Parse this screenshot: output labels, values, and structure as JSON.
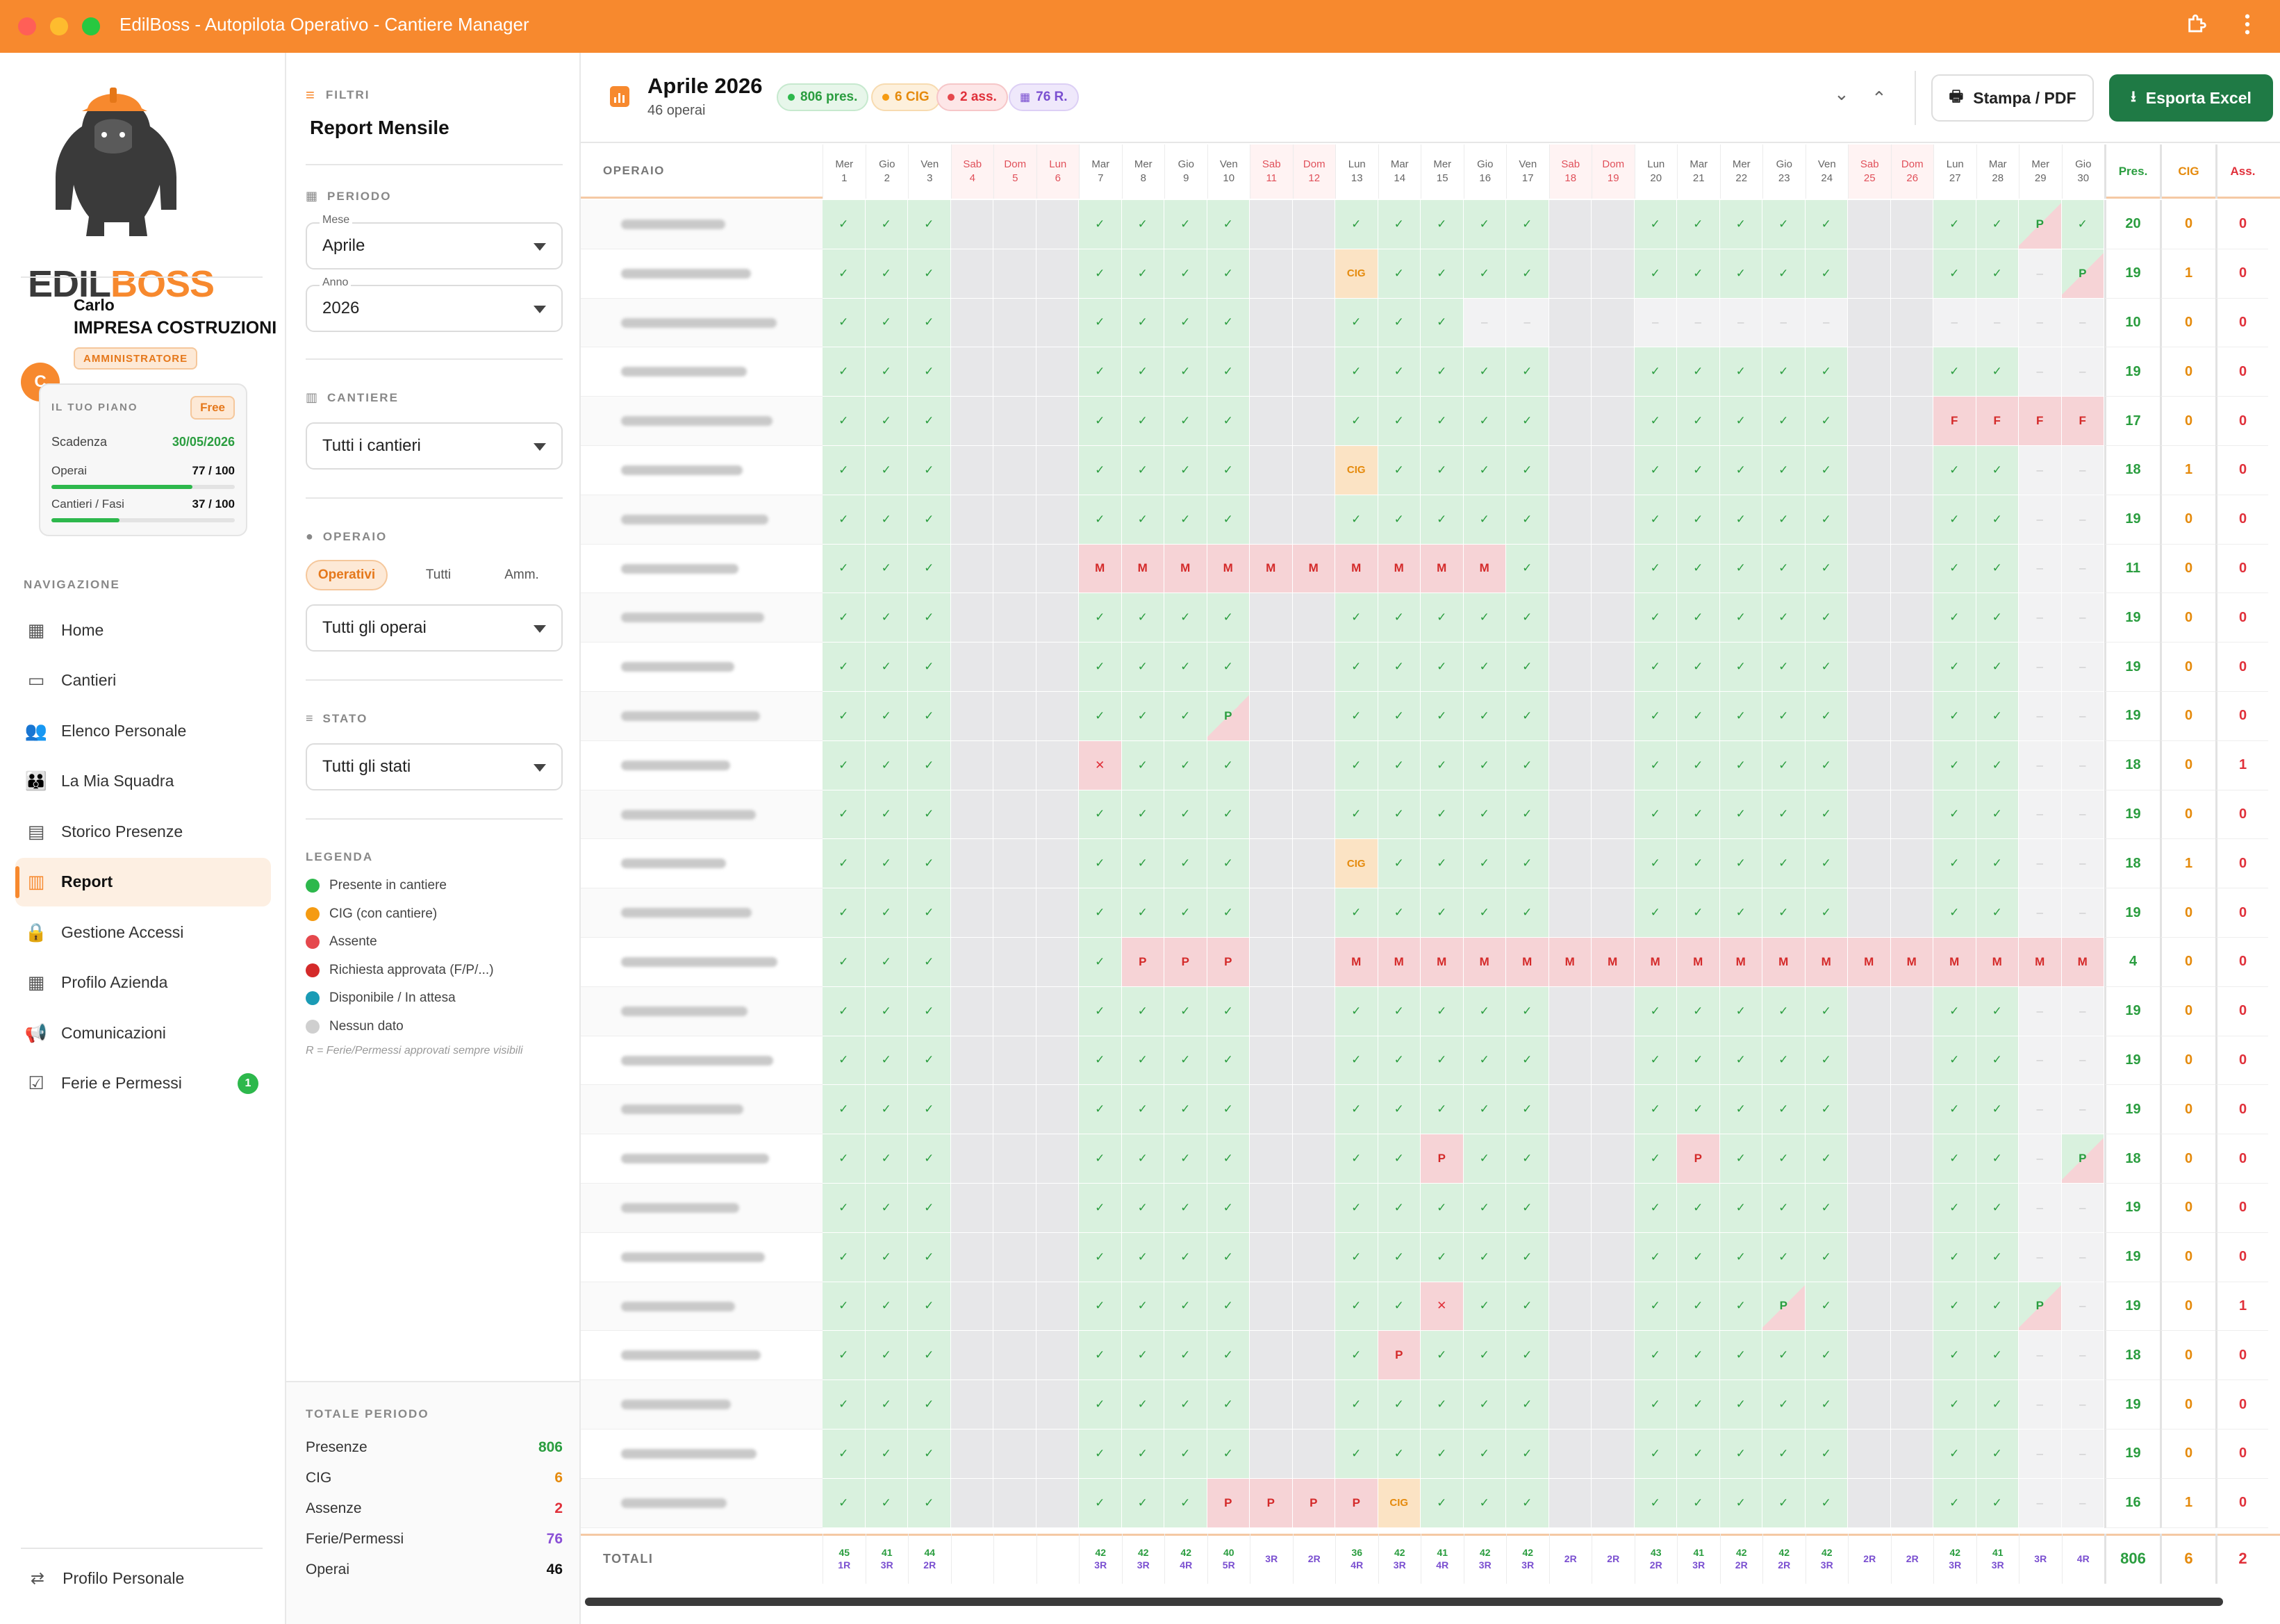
{
  "window": {
    "title": "EdilBoss - Autopilota Operativo - Cantiere Manager"
  },
  "brand": {
    "logo_text_1": "EDIL",
    "logo_text_2": "BOSS",
    "accent": "#f7892e"
  },
  "user": {
    "avatar_letter": "C",
    "first_name": "Carlo",
    "company": "IMPRESA COSTRUZIONI",
    "role": "AMMINISTRATORE"
  },
  "plan": {
    "title": "IL TUO PIANO",
    "tier": "Free",
    "expiry_label": "Scadenza",
    "expiry_value": "30/05/2026",
    "workers_label": "Operai",
    "workers_value": "77 / 100",
    "workers_fraction": 0.77,
    "sites_label": "Cantieri / Fasi",
    "sites_value": "37 / 100",
    "sites_fraction": 0.37
  },
  "nav": {
    "section": "NAVIGAZIONE",
    "items": [
      {
        "label": "Home",
        "icon": "dashboard-icon"
      },
      {
        "label": "Cantieri",
        "icon": "building-icon"
      },
      {
        "label": "Elenco Personale",
        "icon": "people-icon"
      },
      {
        "label": "La Mia Squadra",
        "icon": "team-icon"
      },
      {
        "label": "Storico Presenze",
        "icon": "calendar-icon"
      },
      {
        "label": "Report",
        "icon": "report-icon",
        "active": true
      },
      {
        "label": "Gestione Accessi",
        "icon": "lock-icon"
      },
      {
        "label": "Profilo Azienda",
        "icon": "company-icon"
      },
      {
        "label": "Comunicazioni",
        "icon": "megaphone-icon"
      },
      {
        "label": "Ferie e Permessi",
        "icon": "calendar-check-icon",
        "badge": "1"
      }
    ],
    "profile": "Profilo Personale"
  },
  "filters": {
    "header": "FILTRI",
    "title": "Report Mensile",
    "period_label": "PERIODO",
    "month_label": "Mese",
    "month_value": "Aprile",
    "year_label": "Anno",
    "year_value": "2026",
    "site_label": "CANTIERE",
    "site_value": "Tutti i cantieri",
    "worker_label": "OPERAIO",
    "worker_tabs": [
      "Operativi",
      "Tutti",
      "Amm."
    ],
    "worker_value": "Tutti gli operai",
    "status_label": "STATO",
    "status_value": "Tutti gli stati",
    "legend_label": "LEGENDA",
    "legend": [
      {
        "label": "Presente in cantiere",
        "color": "#2db84c"
      },
      {
        "label": "CIG (con cantiere)",
        "color": "#f59b12"
      },
      {
        "label": "Assente",
        "color": "#e5484d"
      },
      {
        "label": "Richiesta approvata (F/P/...)",
        "color": "#d42a2a"
      },
      {
        "label": "Disponibile / In attesa",
        "color": "#1a9bb5"
      },
      {
        "label": "Nessun dato",
        "color": "#cfcfcf"
      }
    ],
    "legend_note": "R = Ferie/Permessi approvati sempre visibili"
  },
  "period_totals": {
    "title": "TOTALE PERIODO",
    "rows": [
      {
        "label": "Presenze",
        "value": "806",
        "color": "#2a9d3f"
      },
      {
        "label": "CIG",
        "value": "6",
        "color": "#e58a0c"
      },
      {
        "label": "Assenze",
        "value": "2",
        "color": "#e0303a"
      },
      {
        "label": "Ferie/Permessi",
        "value": "76",
        "color": "#8a4fd6"
      },
      {
        "label": "Operai",
        "value": "46",
        "color": "#111"
      }
    ]
  },
  "report": {
    "title": "Aprile 2026",
    "subtitle": "46 operai",
    "pills": [
      {
        "text": "806 pres.",
        "color": "#2a9d3f",
        "bg": "#e7f6ea"
      },
      {
        "text": "6 CIG",
        "color": "#e58a0c",
        "bg": "#fdf0dc"
      },
      {
        "text": "2 ass.",
        "color": "#e0303a",
        "bg": "#fde6e7"
      },
      {
        "text": "76 R.",
        "color": "#7a4fd0",
        "bg": "#efe8fb"
      }
    ],
    "print_button": "Stampa / PDF",
    "export_button": "Esporta Excel",
    "col_operaio": "OPERAIO",
    "col_pres": "Pres.",
    "col_cig": "CIG",
    "col_ass": "Ass.",
    "totals_label": "TOTALI",
    "days": [
      {
        "wd": "Mer",
        "d": "1"
      },
      {
        "wd": "Gio",
        "d": "2"
      },
      {
        "wd": "Ven",
        "d": "3"
      },
      {
        "wd": "Sab",
        "d": "4",
        "we": true
      },
      {
        "wd": "Dom",
        "d": "5",
        "we": true
      },
      {
        "wd": "Lun",
        "d": "6",
        "we": true
      },
      {
        "wd": "Mar",
        "d": "7"
      },
      {
        "wd": "Mer",
        "d": "8"
      },
      {
        "wd": "Gio",
        "d": "9"
      },
      {
        "wd": "Ven",
        "d": "10"
      },
      {
        "wd": "Sab",
        "d": "11",
        "we": true
      },
      {
        "wd": "Dom",
        "d": "12",
        "we": true
      },
      {
        "wd": "Lun",
        "d": "13"
      },
      {
        "wd": "Mar",
        "d": "14"
      },
      {
        "wd": "Mer",
        "d": "15"
      },
      {
        "wd": "Gio",
        "d": "16"
      },
      {
        "wd": "Ven",
        "d": "17"
      },
      {
        "wd": "Sab",
        "d": "18",
        "we": true
      },
      {
        "wd": "Dom",
        "d": "19",
        "we": true
      },
      {
        "wd": "Lun",
        "d": "20"
      },
      {
        "wd": "Mar",
        "d": "21"
      },
      {
        "wd": "Mer",
        "d": "22"
      },
      {
        "wd": "Gio",
        "d": "23"
      },
      {
        "wd": "Ven",
        "d": "24"
      },
      {
        "wd": "Sab",
        "d": "25",
        "we": true
      },
      {
        "wd": "Dom",
        "d": "26",
        "we": true
      },
      {
        "wd": "Lun",
        "d": "27"
      },
      {
        "wd": "Mar",
        "d": "28"
      },
      {
        "wd": "Mer",
        "d": "29"
      },
      {
        "wd": "Gio",
        "d": "30"
      }
    ],
    "rows": [
      {
        "pres": "20",
        "cig": "0",
        "ass": "0",
        "ex": {
          "29": "P/"
        }
      },
      {
        "pres": "19",
        "cig": "1",
        "ass": "0",
        "ex": {
          "13": "C",
          "29": "-",
          "30": "P/"
        }
      },
      {
        "pres": "10",
        "cig": "0",
        "ass": "0",
        "ex": {
          "16": "-",
          "17": "-",
          "20": "-",
          "21": "-",
          "22": "-",
          "23": "-",
          "24": "-",
          "27": "-",
          "28": "-",
          "29": "-",
          "30": "-"
        }
      },
      {
        "pres": "19",
        "cig": "0",
        "ass": "0",
        "ex": {
          "29": "-",
          "30": "-"
        }
      },
      {
        "pres": "17",
        "cig": "0",
        "ass": "0",
        "ex": {
          "27": "F",
          "28": "F",
          "29": "F",
          "30": "F"
        }
      },
      {
        "pres": "18",
        "cig": "1",
        "ass": "0",
        "ex": {
          "13": "C",
          "29": "-",
          "30": "-"
        }
      },
      {
        "pres": "19",
        "cig": "0",
        "ass": "0",
        "ex": {
          "29": "-",
          "30": "-"
        }
      },
      {
        "pres": "11",
        "cig": "0",
        "ass": "0",
        "ex": {
          "7": "M",
          "8": "M",
          "9": "M",
          "10": "M",
          "11": "M",
          "12": "M",
          "13": "M",
          "14": "M",
          "15": "M",
          "16": "M",
          "29": "-",
          "30": "-"
        }
      },
      {
        "pres": "19",
        "cig": "0",
        "ass": "0",
        "ex": {
          "29": "-",
          "30": "-"
        }
      },
      {
        "pres": "19",
        "cig": "0",
        "ass": "0",
        "ex": {
          "29": "-",
          "30": "-"
        }
      },
      {
        "pres": "19",
        "cig": "0",
        "ass": "0",
        "ex": {
          "10": "P/",
          "29": "-",
          "30": "-"
        }
      },
      {
        "pres": "18",
        "cig": "0",
        "ass": "1",
        "ex": {
          "7": "X",
          "29": "-",
          "30": "-"
        }
      },
      {
        "pres": "19",
        "cig": "0",
        "ass": "0",
        "ex": {
          "29": "-",
          "30": "-"
        }
      },
      {
        "pres": "18",
        "cig": "1",
        "ass": "0",
        "ex": {
          "13": "C",
          "29": "-",
          "30": "-"
        }
      },
      {
        "pres": "19",
        "cig": "0",
        "ass": "0",
        "ex": {
          "29": "-",
          "30": "-"
        }
      },
      {
        "pres": "4",
        "cig": "0",
        "ass": "0",
        "ex": {
          "8": "P",
          "9": "P",
          "10": "P",
          "13": "M",
          "14": "M",
          "15": "M",
          "16": "M",
          "17": "M",
          "18": "M",
          "19": "M",
          "20": "M",
          "21": "M",
          "22": "M",
          "23": "M",
          "24": "M",
          "25": "M",
          "26": "M",
          "27": "M",
          "28": "M",
          "29": "M",
          "30": "M"
        }
      },
      {
        "pres": "19",
        "cig": "0",
        "ass": "0",
        "ex": {
          "29": "-",
          "30": "-"
        }
      },
      {
        "pres": "19",
        "cig": "0",
        "ass": "0",
        "ex": {
          "29": "-",
          "30": "-"
        }
      },
      {
        "pres": "19",
        "cig": "0",
        "ass": "0",
        "ex": {
          "29": "-",
          "30": "-"
        }
      },
      {
        "pres": "18",
        "cig": "0",
        "ass": "0",
        "ex": {
          "15": "P",
          "21": "P",
          "29": "-",
          "30": "P/"
        }
      },
      {
        "pres": "19",
        "cig": "0",
        "ass": "0",
        "ex": {
          "29": "-",
          "30": "-"
        }
      },
      {
        "pres": "19",
        "cig": "0",
        "ass": "0",
        "ex": {
          "29": "-",
          "30": "-"
        }
      },
      {
        "pres": "19",
        "cig": "0",
        "ass": "1",
        "ex": {
          "15": "X",
          "23": "P/",
          "29": "P/",
          "30": "-"
        }
      },
      {
        "pres": "18",
        "cig": "0",
        "ass": "0",
        "ex": {
          "14": "P",
          "29": "-",
          "30": "-"
        }
      },
      {
        "pres": "19",
        "cig": "0",
        "ass": "0",
        "ex": {
          "29": "-",
          "30": "-"
        }
      },
      {
        "pres": "19",
        "cig": "0",
        "ass": "0",
        "ex": {
          "29": "-",
          "30": "-"
        }
      },
      {
        "pres": "16",
        "cig": "1",
        "ass": "0",
        "ex": {
          "10": "P",
          "11": "P",
          "12": "P",
          "13": "P",
          "14": "C",
          "29": "-",
          "30": "-"
        }
      }
    ],
    "totals": [
      [
        "45",
        "1R"
      ],
      [
        "41",
        "3R"
      ],
      [
        "44",
        "2R"
      ],
      [
        "",
        ""
      ],
      [
        "",
        ""
      ],
      [
        "",
        ""
      ],
      [
        "42",
        "3R"
      ],
      [
        "42",
        "3R"
      ],
      [
        "42",
        "4R"
      ],
      [
        "40",
        "5R"
      ],
      [
        "",
        "3R"
      ],
      [
        "",
        "2R"
      ],
      [
        "36",
        "4R"
      ],
      [
        "42",
        "3R"
      ],
      [
        "41",
        "4R"
      ],
      [
        "42",
        "3R"
      ],
      [
        "42",
        "3R"
      ],
      [
        "",
        "2R"
      ],
      [
        "",
        "2R"
      ],
      [
        "43",
        "2R"
      ],
      [
        "41",
        "3R"
      ],
      [
        "42",
        "2R"
      ],
      [
        "42",
        "2R"
      ],
      [
        "42",
        "3R"
      ],
      [
        "",
        "2R"
      ],
      [
        "",
        "2R"
      ],
      [
        "42",
        "3R"
      ],
      [
        "41",
        "3R"
      ],
      [
        "",
        "3R"
      ],
      [
        "",
        "4R"
      ]
    ],
    "totals_pres": "806",
    "totals_cig": "6",
    "totals_ass": "2"
  }
}
